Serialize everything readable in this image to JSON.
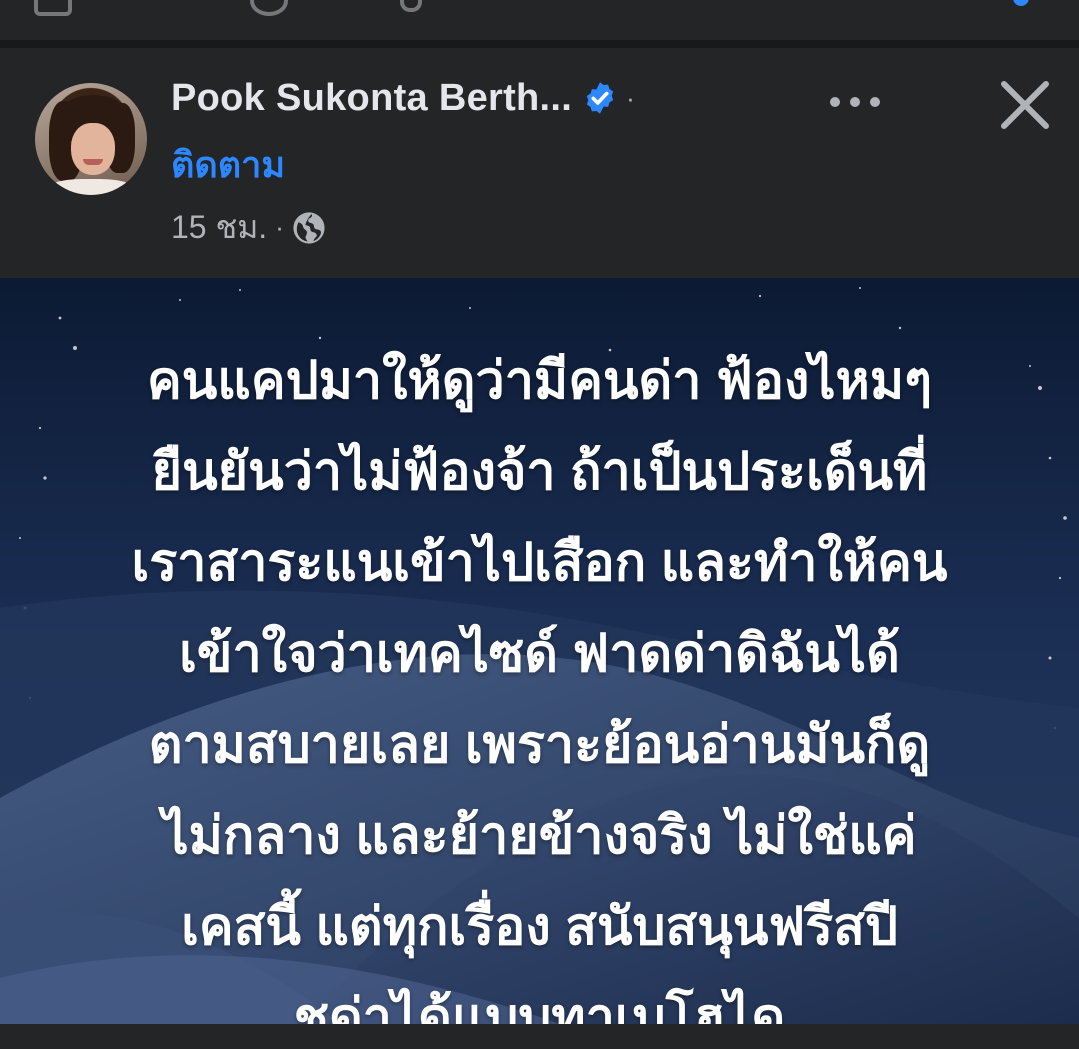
{
  "post": {
    "author_name": "Pook Sukonta Berth...",
    "separator_dot": "·",
    "follow_label": "ติดตาม",
    "timestamp": "15 ชม.",
    "meta_dot": "·",
    "privacy_icon": "globe-icon",
    "verified_icon": "verified-badge-icon",
    "more_icon": "more-options-icon",
    "close_icon": "close-icon",
    "image_text_lines": [
      "คนแคปมาให้ดูว่ามีคนด่า ฟ้องไหมๆ",
      "ยืนยันว่าไม่ฟ้องจ้า ถ้าเป็นประเด็นที่",
      "เราสาระแนเข้าไปเสือก และทำให้คน",
      "เข้าใจว่าเทคไซด์ ฟาดด่าดิฉันได้",
      "ตามสบายเลย เพราะย้อนอ่านมันก็ดู",
      "ไม่กลาง และย้ายข้างจริง ไม่ใช่แค่",
      "เคสนี้ แต่ทุกเรื่อง สนับสนุนฟรีสปี",
      "ชด่าได้แบบทาเบโฮได"
    ]
  },
  "colors": {
    "background": "#242526",
    "text_primary": "#e4e6eb",
    "text_secondary": "#b0b3b8",
    "accent": "#2d88ff",
    "image_bg": "#0f1c33"
  }
}
